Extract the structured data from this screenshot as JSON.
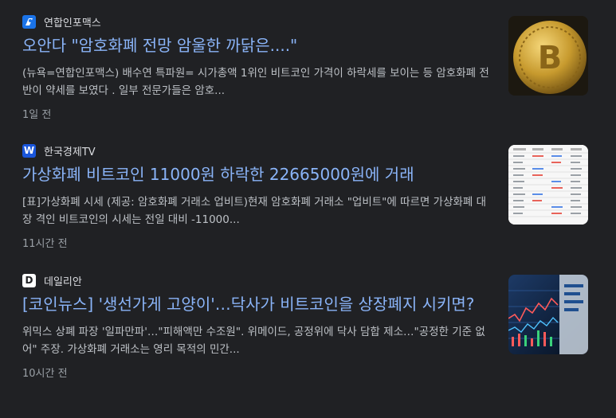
{
  "articles": [
    {
      "source": "연합인포맥스",
      "title": "오안다 \"암호화폐 전망 암울한 까닭은....\"",
      "snippet": "(뉴욕=연합인포맥스) 배수연 특파원= 시가총액 1위인 비트코인 가격이 하락세를 보이는 등 암호화폐 전반이 약세를 보였다 . 일부 전문가들은 암호...",
      "time": "1일 전",
      "logo_icon": "yonhap-infomax-logo-icon",
      "thumbnail_icon": "bitcoin-coin-image"
    },
    {
      "source": "한국경제TV",
      "title": "가상화폐 비트코인 11000원 하락한 22665000원에 거래",
      "snippet": "[표]가상화폐 시세 (제공: 암호화폐 거래소 업비트)현재 암호화폐 거래소 \"업비트\"에 따르면 가상화폐 대장 격인 비트코인의 시세는 전일 대비 -11000...",
      "time": "11시간 전",
      "logo_icon": "wowtv-logo-icon",
      "thumbnail_icon": "price-table-image"
    },
    {
      "source": "데일리안",
      "title": "[코인뉴스] '생선가게 고양이'…닥사가 비트코인을 상장폐지 시키면?",
      "snippet": "위믹스 상폐 파장 '일파만파'…\"피해액만 수조원\". 위메이드, 공정위에 닥사 담합 제소…\"공정한 기준 없어\" 주장. 가상화폐 거래소는 영리 목적의 민간...",
      "time": "10시간 전",
      "logo_icon": "dailian-logo-icon",
      "thumbnail_icon": "trading-chart-image"
    }
  ],
  "colors": {
    "background": "#202124",
    "title": "#8ab4f8",
    "snippet": "#bdc1c6",
    "time": "#9aa0a6"
  }
}
